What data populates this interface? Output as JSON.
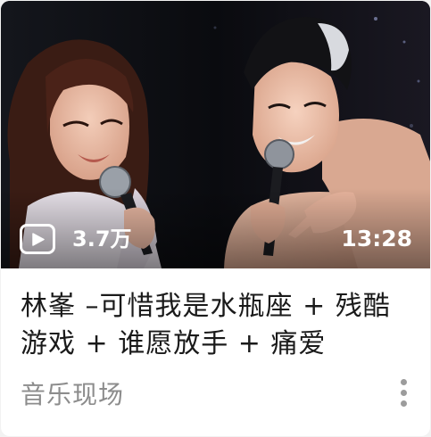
{
  "video": {
    "view_count": "3.7万",
    "duration": "13:28",
    "title": "林峯 –可惜我是水瓶座 + 残酷游戏 + 谁愿放手 + 痛爱",
    "channel": "音乐现场"
  },
  "icons": {
    "play": "play-icon",
    "more": "more-vertical-icon"
  },
  "colors": {
    "title": "#1a1a1a",
    "channel": "#8c8c8c",
    "overlay_text": "#ffffff"
  }
}
